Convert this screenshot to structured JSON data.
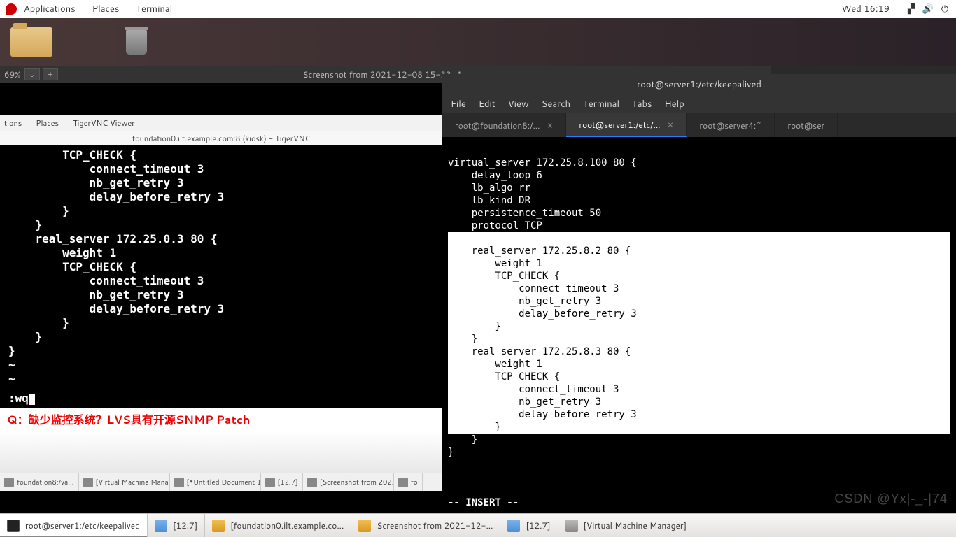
{
  "topbar": {
    "menu": [
      "Applications",
      "Places",
      "Terminal"
    ],
    "clock": "Wed 16:19"
  },
  "zoom": {
    "percent": "69%",
    "title": "Screenshot from 2021-12-08 15-33-4..."
  },
  "inner_topbar": {
    "items": [
      "tions",
      "Places",
      "TigerVNC Viewer"
    ]
  },
  "vnc": {
    "title": "foundation0.ilt.example.com:8 (kiosk) - TigerVNC",
    "text": "        TCP_CHECK {\n            connect_timeout 3\n            nb_get_retry 3\n            delay_before_retry 3\n        }\n    }\n    real_server 172.25.0.3 80 {\n        weight 1\n        TCP_CHECK {\n            connect_timeout 3\n            nb_get_retry 3\n            delay_before_retry 3\n        }\n    }\n}\n~\n~",
    "cmd": ":wq",
    "red": "Q：缺少监控系统？LVS具有开源SNMP Patch"
  },
  "inner_tasks": [
    "foundation8:/va...",
    "[Virtual Machine Manag...",
    "[*Untitled Document 1...",
    "[12.7]",
    "[Screenshot from 202...",
    "fo"
  ],
  "term": {
    "title": "root@server1:/etc/keepalived",
    "menu": [
      "File",
      "Edit",
      "View",
      "Search",
      "Terminal",
      "Tabs",
      "Help"
    ],
    "tabs": [
      {
        "label": "root@foundation8:/...",
        "active": false,
        "closable": true
      },
      {
        "label": "root@server1:/etc/...",
        "active": true,
        "closable": true
      },
      {
        "label": "root@server4:~",
        "active": false,
        "closable": false
      },
      {
        "label": "root@ser",
        "active": false,
        "closable": false
      }
    ],
    "pre": "\nvirtual_server 172.25.8.100 80 {\n    delay_loop 6\n    lb_algo rr\n    lb_kind DR\n    persistence_timeout 50\n    protocol TCP\n",
    "hl": "\n    real_server 172.25.8.2 80 {\n        weight 1\n        TCP_CHECK {\n            connect_timeout 3\n            nb_get_retry 3\n            delay_before_retry 3\n        }\n    }\n    real_server 172.25.8.3 80 {\n        weight 1\n        TCP_CHECK {\n            connect_timeout 3\n            nb_get_retry 3\n            delay_before_retry 3\n        }",
    "post": "    }\n}\n\n\n\n",
    "status": "-- INSERT --"
  },
  "taskbar": [
    {
      "label": "root@server1:/etc/keepalived",
      "icon": "ti-term",
      "active": true
    },
    {
      "label": "[12.7]",
      "icon": "ti-doc"
    },
    {
      "label": "[foundation0.ilt.example.co...",
      "icon": "ti-img"
    },
    {
      "label": "Screenshot from 2021-12-...",
      "icon": "ti-img"
    },
    {
      "label": "[12.7]",
      "icon": "ti-doc"
    },
    {
      "label": "[Virtual Machine Manager]",
      "icon": "ti-vm"
    }
  ],
  "watermark": "CSDN @Yx|-_-|74"
}
